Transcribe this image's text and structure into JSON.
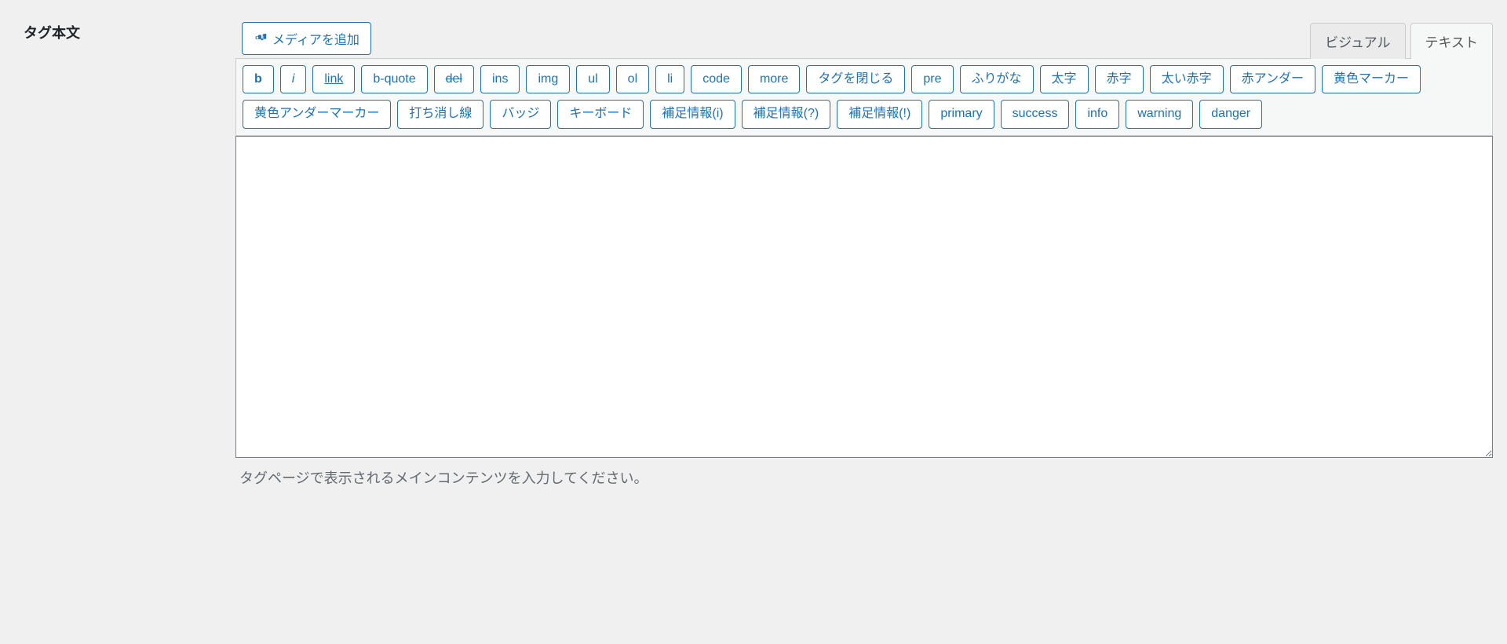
{
  "field": {
    "label": "タグ本文"
  },
  "media": {
    "add_label": "メディアを追加"
  },
  "tabs": {
    "visual": "ビジュアル",
    "text": "テキスト"
  },
  "quicktags": {
    "b": "b",
    "i": "i",
    "link": "link",
    "b_quote": "b-quote",
    "del": "del",
    "ins": "ins",
    "img": "img",
    "ul": "ul",
    "ol": "ol",
    "li": "li",
    "code": "code",
    "more": "more",
    "close_tags": "タグを閉じる",
    "pre": "pre",
    "furigana": "ふりがな",
    "bold_text": "太字",
    "red_text": "赤字",
    "bold_red_text": "太い赤字",
    "red_under": "赤アンダー",
    "yellow_marker": "黄色マーカー",
    "yellow_under_marker": "黄色アンダーマーカー",
    "strikethrough": "打ち消し線",
    "badge": "バッジ",
    "keyboard": "キーボード",
    "info_i": "補足情報(i)",
    "info_q": "補足情報(?)",
    "info_ex": "補足情報(!)",
    "primary": "primary",
    "success": "success",
    "info": "info",
    "warning": "warning",
    "danger": "danger"
  },
  "editor": {
    "value": ""
  },
  "help": {
    "text": "タグページで表示されるメインコンテンツを入力してください。"
  }
}
